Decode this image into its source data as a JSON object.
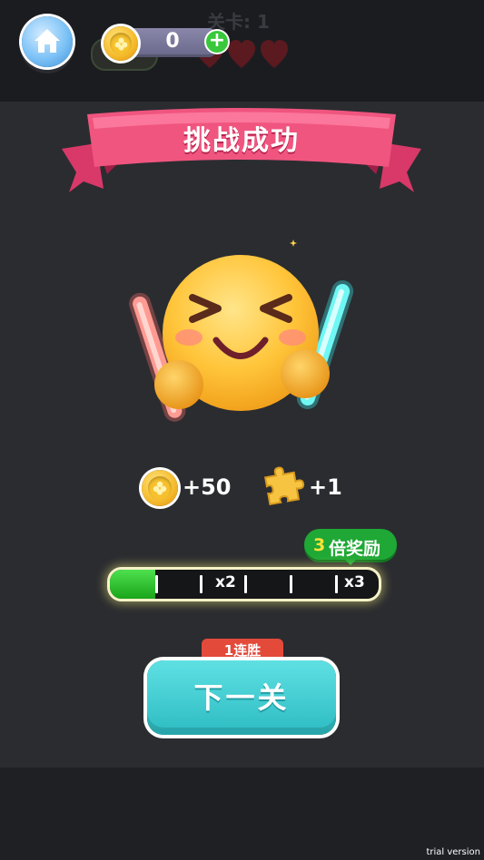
{
  "header": {
    "level_label": "关卡: 1",
    "coin_count": "0",
    "plus_label": "+",
    "lives": 3
  },
  "result": {
    "title": "挑战成功"
  },
  "rewards": {
    "coins": "+50",
    "pieces": "+1"
  },
  "multiplier": {
    "badge_number": "3",
    "badge_text": "倍奖励",
    "progress": 0.17,
    "marks": [
      "x2",
      "x3"
    ]
  },
  "streak": {
    "label": "1连胜"
  },
  "next_button": {
    "label": "下一关"
  },
  "watermark": "trial version",
  "colors": {
    "ribbon": "#f0557f",
    "next_button": "#3fc9cf",
    "progress_fill": "#2fc42f",
    "badge": "#1fa835",
    "streak_tag": "#e34a3a"
  }
}
